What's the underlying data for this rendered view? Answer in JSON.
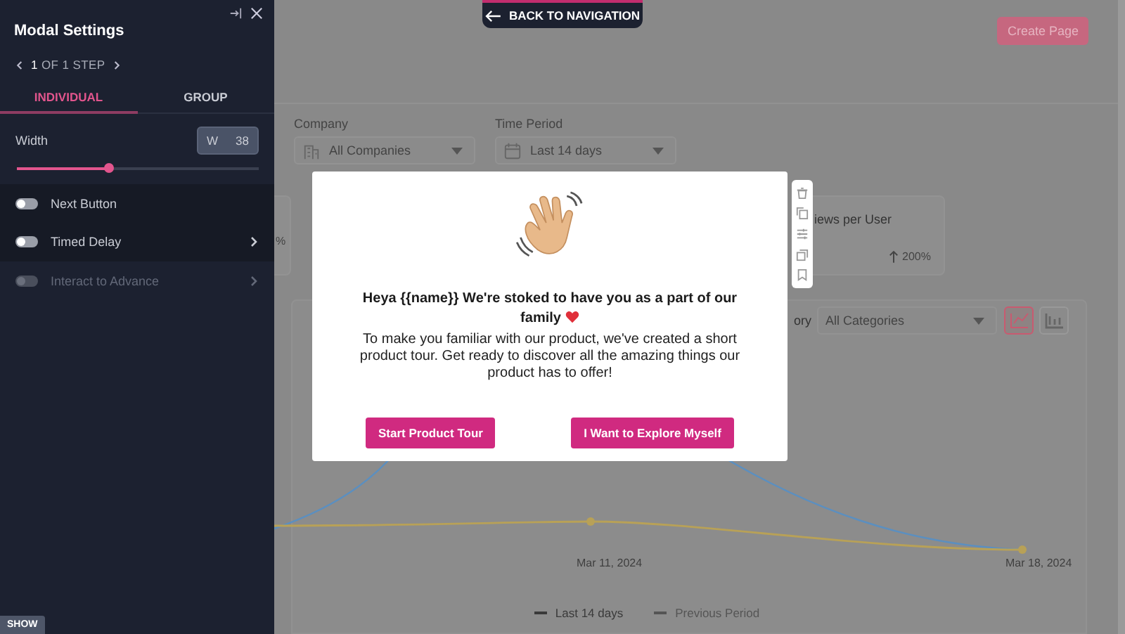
{
  "sidebar": {
    "title": "Modal Settings",
    "step": "**1** OF 1 STEP",
    "tabs": [
      {
        "label": "INDIVIDUAL",
        "selected": true
      },
      {
        "label": "GROUP",
        "selected": false
      }
    ],
    "width": {
      "label": "Width",
      "prefix": "W",
      "value": "38",
      "level": 0.38
    },
    "toggles": [
      {
        "label": "Next Button",
        "on": false,
        "disabled": false,
        "expandable": false
      },
      {
        "label": "Timed Delay",
        "on": false,
        "disabled": false,
        "expandable": true
      },
      {
        "label": "Interact to Advance",
        "on": false,
        "disabled": true,
        "expandable": true
      }
    ],
    "show_button": "SHOW"
  },
  "back_button": "BACK TO NAVIGATION",
  "page": {
    "create_button": "Create Page",
    "filters": [
      {
        "label": "Company",
        "value": "All Companies"
      },
      {
        "label": "Time Period",
        "value": "Last 14 days"
      }
    ],
    "cards": [
      {
        "trend": "%"
      },
      {
        "title": "iews per User",
        "trend": "200%"
      }
    ],
    "chart_panel": {
      "filter_label": "ory",
      "category": "All Categories",
      "views": [
        {
          "kind": "line",
          "selected": true
        },
        {
          "kind": "bar",
          "selected": false
        }
      ],
      "x_labels": [
        "Mar 11, 2024",
        "Mar 18, 2024"
      ],
      "legend": [
        {
          "label": "Last 14 days",
          "kind": "solid"
        },
        {
          "label": "Previous Period",
          "kind": "dashed"
        }
      ]
    }
  },
  "modal": {
    "title": "Heya {{name}} We're stoked to have you as a part of our family",
    "body": "To make you familiar with our product, we've created a short product tour. Get ready to discover all the amazing things our product has to offer!",
    "buttons": [
      "Start Product Tour",
      "I Want to Explore Myself"
    ]
  }
}
